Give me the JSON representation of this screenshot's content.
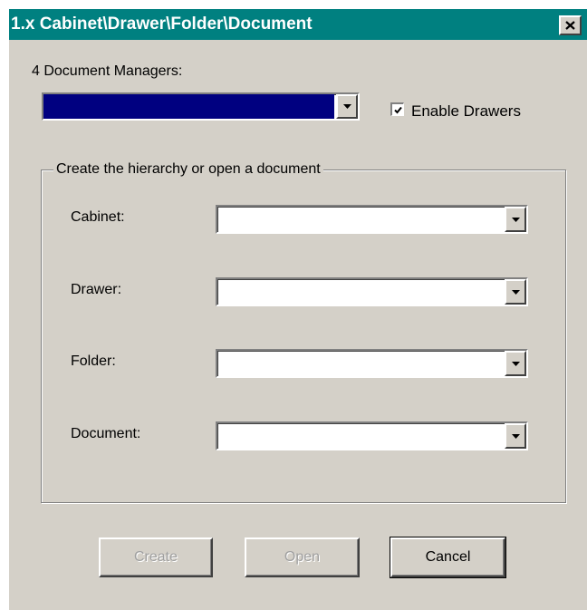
{
  "window": {
    "title": "1.x Cabinet\\Drawer\\Folder\\Document",
    "close_label": "×"
  },
  "managers": {
    "label": "4 Document Managers:",
    "selected_value": ""
  },
  "enable_drawers": {
    "label": "Enable Drawers",
    "checked": true
  },
  "group": {
    "legend": "Create the hierarchy or open a document",
    "fields": [
      {
        "label": "Cabinet:",
        "value": ""
      },
      {
        "label": "Drawer:",
        "value": ""
      },
      {
        "label": "Folder:",
        "value": ""
      },
      {
        "label": "Document:",
        "value": ""
      }
    ]
  },
  "buttons": {
    "create": {
      "label": "Create",
      "enabled": false
    },
    "open": {
      "label": "Open",
      "enabled": false
    },
    "cancel": {
      "label": "Cancel",
      "enabled": true
    }
  },
  "colors": {
    "titlebar": "#008080",
    "face": "#d4d0c8",
    "selection": "#000080"
  },
  "icons": {
    "close": "close-icon",
    "dropdown": "chevron-down-icon",
    "check": "check-icon"
  }
}
